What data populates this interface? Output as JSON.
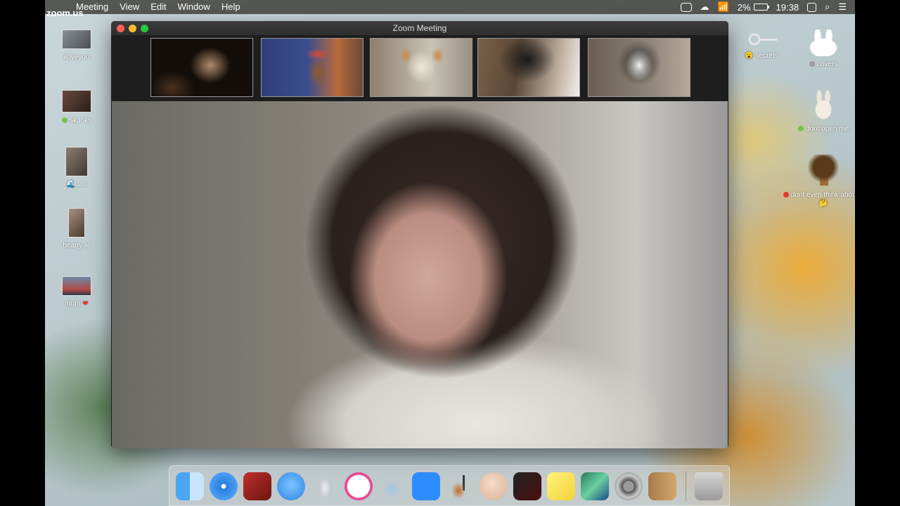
{
  "menubar": {
    "app_name": "zoom.us",
    "menus": [
      "Meeting",
      "View",
      "Edit",
      "Window",
      "Help"
    ],
    "battery_percent": "2%",
    "time": "19:38"
  },
  "desktop_icons_left": [
    {
      "label": "iloveyou",
      "status": ""
    },
    {
      "label": "skunks",
      "status": "green"
    },
    {
      "label": "tati",
      "status": "wave"
    },
    {
      "label": "beany",
      "status": "skull"
    },
    {
      "label": "mum",
      "status": "heart"
    }
  ],
  "desktop_icons_right": [
    {
      "label": "secrets",
      "status": "face"
    },
    {
      "label": "covers",
      "status": "gray"
    },
    {
      "label": "dont open me",
      "status": "green"
    },
    {
      "label": "dont even think about it",
      "status": "red"
    }
  ],
  "zoom": {
    "window_title": "Zoom Meeting",
    "thumbnails": [
      "participant-1",
      "participant-2",
      "participant-3",
      "participant-4",
      "participant-5"
    ]
  },
  "dock": {
    "apps": [
      "finder-icon",
      "safari-icon",
      "photo-booth-icon",
      "messages-icon",
      "rodent-icon",
      "itunes-icon",
      "seal-icon",
      "zoom-icon",
      "garageband-icon",
      "face-icon",
      "photo-app-icon",
      "stickies-icon",
      "preview-icon",
      "system-preferences-icon",
      "contacts-icon",
      "trash-icon"
    ]
  },
  "colors": {
    "menubar_bg": "#3c3c37",
    "zoom_window_bg": "#1e1e1e",
    "close": "#fc5f57",
    "minimize": "#fdbc2e",
    "maximize": "#28c840"
  }
}
